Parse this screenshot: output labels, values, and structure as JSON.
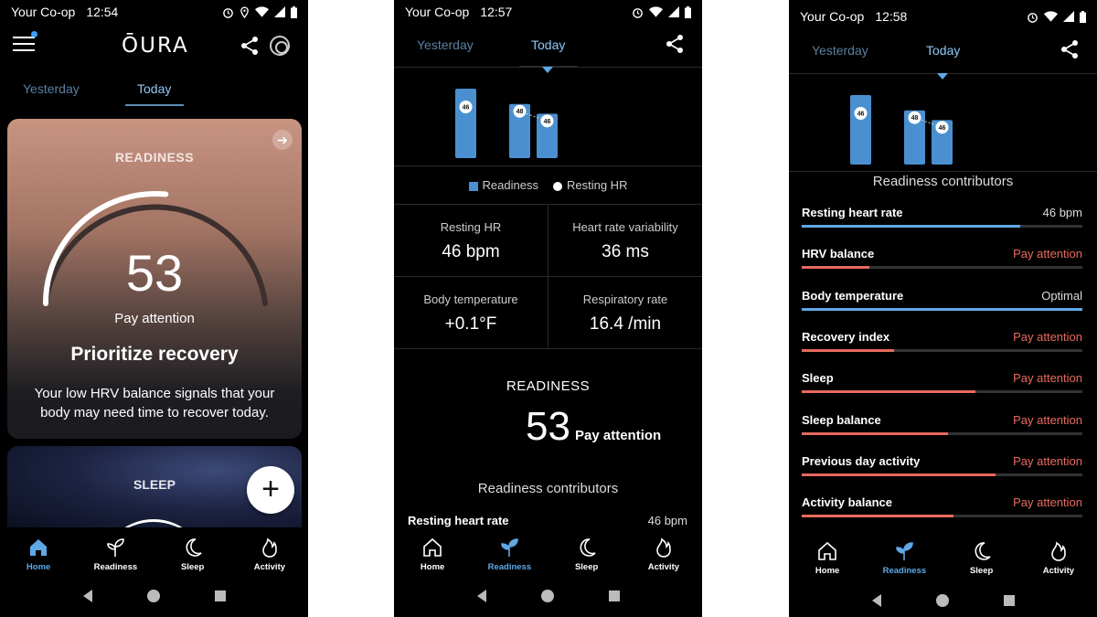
{
  "status": {
    "carrier": "Your Co-op",
    "times": [
      "12:54",
      "12:57",
      "12:58"
    ]
  },
  "tabs": {
    "yesterday": "Yesterday",
    "today": "Today"
  },
  "nav": {
    "home": "Home",
    "readiness": "Readiness",
    "sleep": "Sleep",
    "activity": "Activity"
  },
  "home": {
    "logo": "ŌURA",
    "readiness_title": "READINESS",
    "score": "53",
    "score_fraction": 0.53,
    "status": "Pay attention",
    "headline": "Prioritize recovery",
    "body": "Your low HRV balance signals that your body may need time to recover today.",
    "sleep_title": "SLEEP",
    "fab_label": "+"
  },
  "readiness_chart": {
    "bars": [
      {
        "label": "46",
        "value": 46
      },
      {
        "label": "48",
        "value": 48
      },
      {
        "label": "46",
        "value": 46
      }
    ],
    "legend": [
      "Readiness",
      "Resting HR"
    ]
  },
  "metrics": [
    {
      "label": "Resting HR",
      "value": "46 bpm"
    },
    {
      "label": "Heart rate variability",
      "value": "36 ms"
    },
    {
      "label": "Body temperature",
      "value": "+0.1°F"
    },
    {
      "label": "Respiratory rate",
      "value": "16.4 /min"
    }
  ],
  "readiness_detail": {
    "title": "READINESS",
    "score": "53",
    "status": "Pay attention",
    "contributors_title": "Readiness contributors",
    "first_row_label": "Resting heart rate",
    "first_row_value": "46 bpm"
  },
  "contributors": [
    {
      "label": "Resting heart rate",
      "value": "46 bpm",
      "level": 0.78,
      "color": "#5fa8e6",
      "warn": false
    },
    {
      "label": "HRV balance",
      "value": "Pay attention",
      "level": 0.24,
      "color": "#e76a5e",
      "warn": true
    },
    {
      "label": "Body temperature",
      "value": "Optimal",
      "level": 1.0,
      "color": "#5fa8e6",
      "warn": false
    },
    {
      "label": "Recovery index",
      "value": "Pay attention",
      "level": 0.33,
      "color": "#e76a5e",
      "warn": true
    },
    {
      "label": "Sleep",
      "value": "Pay attention",
      "level": 0.62,
      "color": "#e76a5e",
      "warn": true
    },
    {
      "label": "Sleep balance",
      "value": "Pay attention",
      "level": 0.52,
      "color": "#e76a5e",
      "warn": true
    },
    {
      "label": "Previous day activity",
      "value": "Pay attention",
      "level": 0.69,
      "color": "#e76a5e",
      "warn": true
    },
    {
      "label": "Activity balance",
      "value": "Pay attention",
      "level": 0.54,
      "color": "#e76a5e",
      "warn": true
    }
  ],
  "colors": {
    "accent": "#5fa8e6",
    "warn": "#e76a5e",
    "bar": "#4a90d0"
  }
}
